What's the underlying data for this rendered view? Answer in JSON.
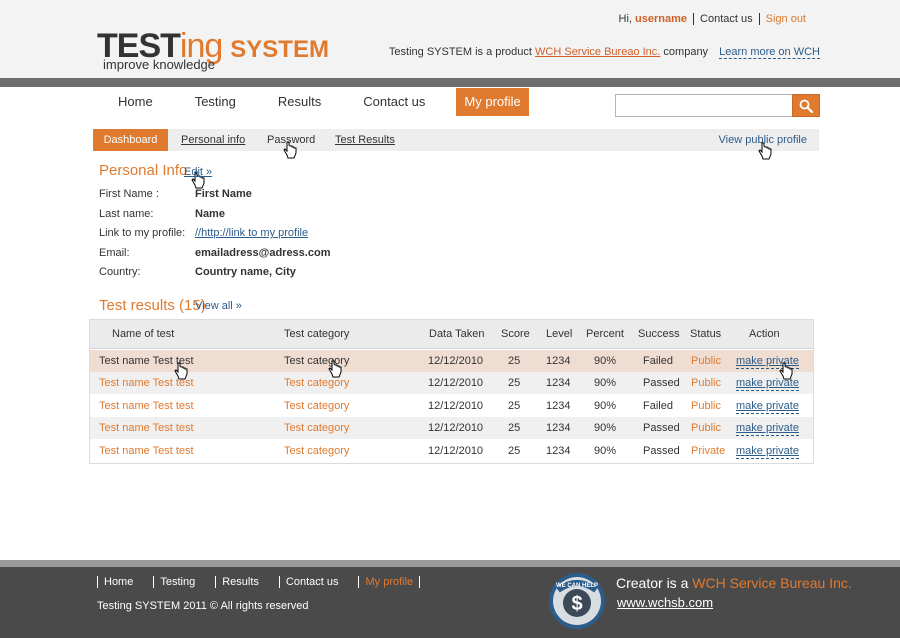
{
  "header": {
    "logo_test": "TEST",
    "logo_ing": "ing",
    "logo_system": "SYSTEM",
    "tagline": "improve knowledge",
    "greeting": "Hi,",
    "username": "username",
    "contact_us": "Contact us",
    "sign_out": "Sign out",
    "product_prefix": "Testing SYSTEM is a product",
    "product_company": "WCH Service Bureao Inc.",
    "product_suffix": "company",
    "learn_more": "Learn more on WCH"
  },
  "nav": {
    "items": [
      "Home",
      "Testing",
      "Results",
      "Contact us",
      "My profile"
    ],
    "active": "My profile"
  },
  "search": {
    "value": "",
    "placeholder": "",
    "icon": "search-icon"
  },
  "subtabs": {
    "items": [
      "Dashboard",
      "Personal info",
      "Password",
      "Test Results"
    ],
    "active": "Dashboard",
    "view_public": "View public profile"
  },
  "personal_info": {
    "title": "Personal Info",
    "edit": "Edit »",
    "fields": [
      {
        "label": "First Name :",
        "value": "First Name"
      },
      {
        "label": "Last name:",
        "value": "Name"
      },
      {
        "label": "Link to my profile:",
        "value": "//http://link to my profile"
      },
      {
        "label": "Email:",
        "value": "emailadress@adress.com"
      },
      {
        "label": "Country:",
        "value": "Country name, City"
      }
    ]
  },
  "test_results": {
    "title": "Test results (15)",
    "view_all": "View all »",
    "columns": [
      "Name of test",
      "Test category",
      "Data Taken",
      "Score",
      "Level",
      "Percent",
      "Success",
      "Status",
      "Action"
    ],
    "rows": [
      {
        "name": "Test name Test test",
        "category": "Test category",
        "date": "12/12/2010",
        "score": "25",
        "level": "1234",
        "percent": "90%",
        "success": "Failed",
        "status": "Public",
        "action": "make private"
      },
      {
        "name": "Test name Test test",
        "category": "Test category",
        "date": "12/12/2010",
        "score": "25",
        "level": "1234",
        "percent": "90%",
        "success": "Passed",
        "status": "Public",
        "action": "make private"
      },
      {
        "name": "Test name Test test",
        "category": "Test category",
        "date": "12/12/2010",
        "score": "25",
        "level": "1234",
        "percent": "90%",
        "success": "Failed",
        "status": "Public",
        "action": "make private"
      },
      {
        "name": "Test name Test test",
        "category": "Test category",
        "date": "12/12/2010",
        "score": "25",
        "level": "1234",
        "percent": "90%",
        "success": "Passed",
        "status": "Public",
        "action": "make private"
      },
      {
        "name": "Test name Test test",
        "category": "Test category",
        "date": "12/12/2010",
        "score": "25",
        "level": "1234",
        "percent": "90%",
        "success": "Passed",
        "status": "Private",
        "action": "make private"
      }
    ]
  },
  "footer": {
    "nav": [
      "Home",
      "Testing",
      "Results",
      "Contact us",
      "My profile"
    ],
    "copyright": "Testing SYSTEM   2011 © All rights reserved",
    "badge_text": "WE CAN HELP",
    "creator_prefix": "Creator is a",
    "creator_org": "WCH Service Bureau Inc.",
    "site": "www.wchsb.com"
  },
  "colors": {
    "accent": "#e07a2f",
    "link": "#2b5c8a",
    "footer_bg": "#4a4a4a"
  }
}
